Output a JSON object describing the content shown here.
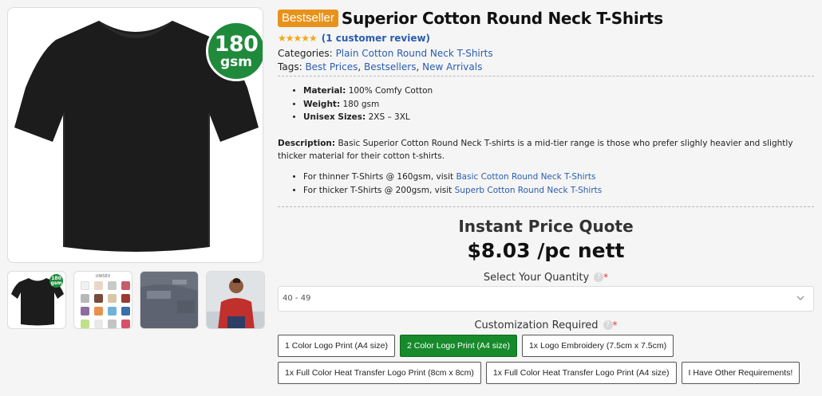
{
  "gallery": {
    "badge_number": "180",
    "badge_unit": "gsm",
    "thumbs": [
      {
        "name": "black-tshirt",
        "badge": "180 gsm"
      },
      {
        "name": "color-chart",
        "label": "UNISEX"
      },
      {
        "name": "fabric-tag"
      },
      {
        "name": "model-photo"
      }
    ]
  },
  "product": {
    "badge": "Bestseller",
    "title": "Superior Cotton Round Neck T-Shirts",
    "rating_stars": 5,
    "review_link": "(1 customer review)",
    "categories_label": "Categories:",
    "categories": [
      "Plain Cotton Round Neck T-Shirts"
    ],
    "tags_label": "Tags:",
    "tags": [
      "Best Prices",
      "Bestsellers",
      "New Arrivals"
    ],
    "specs": [
      {
        "k": "Material:",
        "v": "100% Comfy Cotton"
      },
      {
        "k": "Weight:",
        "v": "180 gsm"
      },
      {
        "k": "Unisex Sizes:",
        "v": "2XS – 3XL"
      }
    ],
    "description_label": "Description:",
    "description": "Basic Superior Cotton Round Neck T-shirts is a mid-tier range is those who prefer slighly heavier and slightly thicker material for their cotton t-shirts.",
    "links": [
      {
        "prefix": "For thinner T-Shirts @ 160gsm, visit ",
        "link": "Basic Cotton Round Neck T-Shirts"
      },
      {
        "prefix": "For thicker T-Shirts @ 200gsm, visit ",
        "link": "Superb Cotton Round Neck T-Shirts"
      }
    ]
  },
  "quote": {
    "title": "Instant Price Quote",
    "price": "$8.03 /pc nett",
    "quantity_label": "Select Your Quantity",
    "quantity_value": "40 - 49",
    "customization_label": "Customization Required",
    "options": [
      "1 Color Logo Print (A4 size)",
      "2 Color Logo Print (A4 size)",
      "1x Logo Embroidery (7.5cm x 7.5cm)",
      "1x Full Color Heat Transfer Logo Print (8cm x 8cm)",
      "1x Full Color Heat Transfer Logo Print (A4 size)",
      "I Have Other Requirements!"
    ],
    "selected_option": "2 Color Logo Print (A4 size)"
  },
  "colors": {
    "accent_green": "#1f8a3b",
    "bestseller_orange": "#e8921b",
    "link_blue": "#2a5db0",
    "star_gold": "#f3a712",
    "required_red": "#e23b2e"
  }
}
